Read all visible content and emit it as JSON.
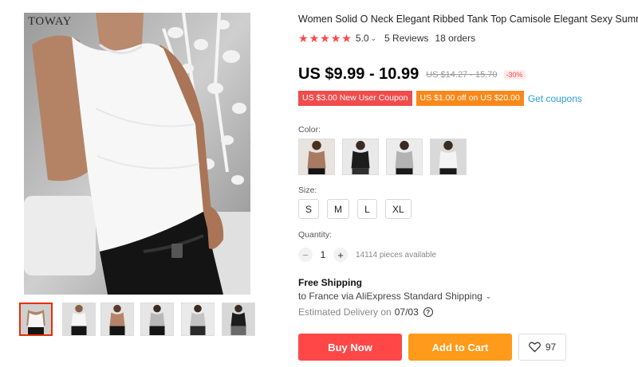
{
  "gallery": {
    "brand_mark": "TOWAY",
    "thumbnails": [
      {
        "shirt_color": "#f2f2f2",
        "active": true
      },
      {
        "shirt_color": "#f2f2f2",
        "active": false
      },
      {
        "shirt_color": "#b5846a",
        "active": false
      },
      {
        "shirt_color": "#b8b8b8",
        "active": false
      },
      {
        "shirt_color": "#c4c4c4",
        "active": false
      },
      {
        "shirt_color": "#1c1c1c",
        "active": false
      }
    ]
  },
  "product": {
    "title": "Women Solid O Neck Elegant Ribbed Tank Top Camisole Elegant Sexy Summer",
    "rating": "5.0",
    "stars": 5,
    "reviews": "5 Reviews",
    "orders": "18 orders",
    "price": "US $9.99 - 10.99",
    "original_price": "US $14.27 - 15.70",
    "discount": "-30%"
  },
  "coupons": {
    "new_user": "US $3.00 New User Coupon",
    "off": "US $1.00 off on US $20.00",
    "get_coupons": "Get coupons"
  },
  "color": {
    "label": "Color:",
    "options": [
      {
        "shirt": "#a97a62"
      },
      {
        "shirt": "#1c1c1c"
      },
      {
        "shirt": "#b3b3b3"
      },
      {
        "shirt": "#f4f4f4"
      }
    ]
  },
  "size": {
    "label": "Size:",
    "options": [
      "S",
      "M",
      "L",
      "XL"
    ]
  },
  "quantity": {
    "label": "Quantity:",
    "minus": "−",
    "plus": "+",
    "value": "1",
    "available": "14114 pieces available"
  },
  "shipping": {
    "title": "Free Shipping",
    "to": "to France via AliExpress Standard Shipping",
    "delivery_label": "Estimated Delivery on",
    "delivery_date": "07/03",
    "help": "?"
  },
  "actions": {
    "buy_now": "Buy Now",
    "add_to_cart": "Add to Cart",
    "wishlist_count": "97"
  },
  "colors": {
    "accent_red": "#ff4747",
    "accent_orange": "#ff9a1a",
    "link_blue": "#2a9fd6"
  },
  "icons": [
    "star-icon",
    "chevron-down-icon",
    "help-circle-icon",
    "heart-icon"
  ]
}
